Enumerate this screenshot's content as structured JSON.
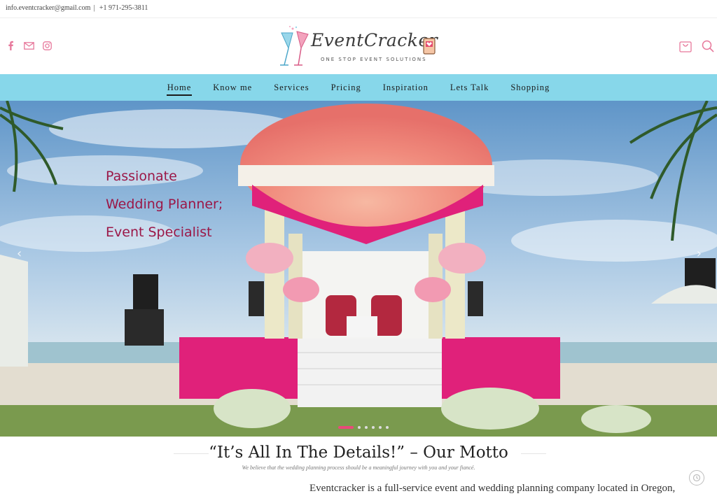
{
  "topbar": {
    "email": "info.eventcracker@gmail.com",
    "separator": "|",
    "phone": "+1 971-295-3811"
  },
  "social": [
    "facebook-icon",
    "mail-icon",
    "instagram-icon"
  ],
  "logo": {
    "brand": "EventCracker",
    "tagline": "ONE STOP EVENT SOLUTIONS"
  },
  "header_icons": [
    "cart-icon",
    "search-icon"
  ],
  "nav": {
    "items": [
      {
        "label": "Home",
        "active": true
      },
      {
        "label": "Know me",
        "active": false
      },
      {
        "label": "Services",
        "active": false
      },
      {
        "label": "Pricing",
        "active": false
      },
      {
        "label": "Inspiration",
        "active": false
      },
      {
        "label": "Lets Talk",
        "active": false
      },
      {
        "label": "Shopping",
        "active": false
      }
    ]
  },
  "hero": {
    "line1": "Passionate",
    "line2": "Wedding Planner;",
    "line3": "Event Specialist",
    "prev": "‹",
    "next": "›",
    "slide_count": 6,
    "active_slide": 1
  },
  "motto": {
    "title": "“It’s All In The Details!” – Our Motto",
    "subtitle": "We believe that the wedding planning process should be a meaningful journey with you and your fiancé."
  },
  "intro": "Eventcracker is a full-service event and wedding planning company located in Oregon,",
  "colors": {
    "nav_bg": "#87d7ea",
    "accent_pink": "#e94a7a",
    "hero_text": "#9b1747"
  }
}
